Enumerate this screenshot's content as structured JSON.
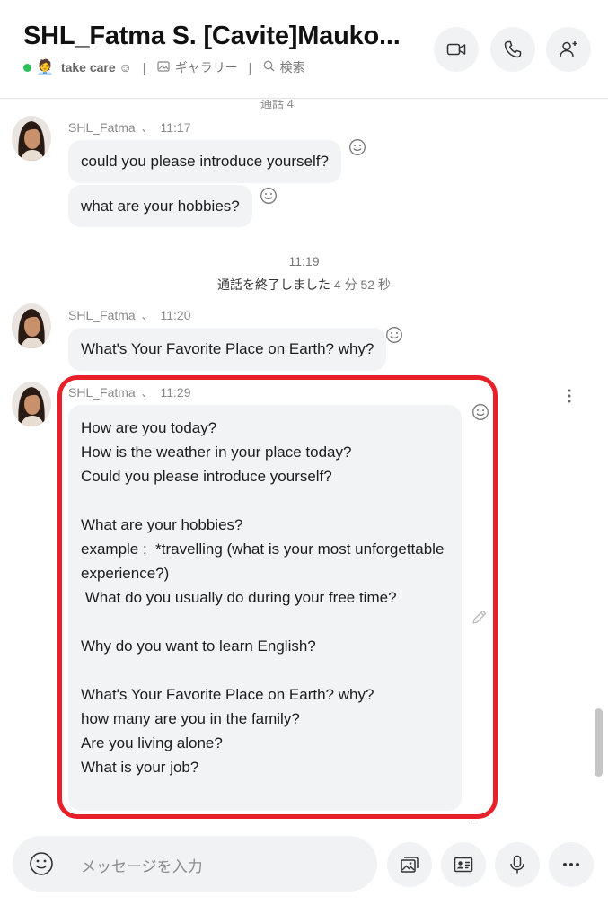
{
  "header": {
    "title": "SHL_Fatma S. [Cavite]Mauko...",
    "status_color": "#2ec05a",
    "mood_emoji": "🧑‍💼",
    "mood_text": "take care ☺",
    "separator": "|",
    "gallery_label": "ギャラリー",
    "search_label": "検索",
    "buttons": [
      "video-call",
      "audio-call",
      "add-participant"
    ]
  },
  "chat": {
    "cut_text": "通話 4",
    "messages": [
      {
        "sender": "SHL_Fatma",
        "time": "11:17",
        "lines": [
          "could you please introduce yourself?",
          "what are your hobbies?"
        ]
      },
      {
        "sender": "SHL_Fatma",
        "time": "11:20",
        "lines": [
          "What's Your Favorite Place on Earth? why?"
        ]
      },
      {
        "sender": "SHL_Fatma",
        "time": "11:29",
        "lines": [
          "How are you today?",
          "How is the weather in your place today?",
          "Could you please introduce yourself?",
          "",
          "What are your hobbies?",
          "example :  *travelling (what is your most unforgettable",
          "experience?)",
          " What do you usually do during your free time?",
          "",
          "Why do you want to learn English?",
          "",
          "What's Your Favorite Place on Earth? why?",
          "how many are you in the family?",
          "Are you living alone?",
          "What is your job?"
        ]
      }
    ],
    "separator_sender_time": "、",
    "center_time": "11:19",
    "call_ended_text": "通話を終了しました",
    "call_duration": "4 分 52 秒",
    "highlight_color": "#e8202a"
  },
  "composer": {
    "placeholder": "メッセージを入力",
    "buttons": [
      "gallery",
      "contact-card",
      "microphone",
      "more-options"
    ]
  }
}
